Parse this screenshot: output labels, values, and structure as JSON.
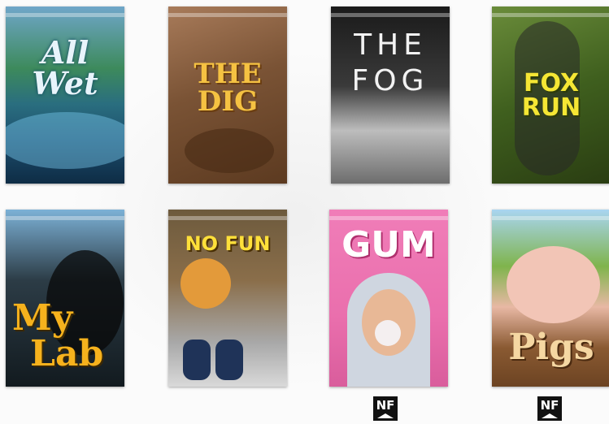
{
  "books": [
    {
      "title_line1": "All",
      "title_line2": "Wet"
    },
    {
      "title_line1": "THE",
      "title_line2": "DIG"
    },
    {
      "title_line1": "THE",
      "title_line2": "FOG"
    },
    {
      "title_line1": "FOX",
      "title_line2": "RUN"
    },
    {
      "title_line1": "My",
      "title_line2": "Lab"
    },
    {
      "title_line1": "NO FUN",
      "title_line2": ""
    },
    {
      "title_line1": "GUM",
      "title_line2": ""
    },
    {
      "title_line1": "Pigs",
      "title_line2": ""
    }
  ],
  "badges": {
    "nf_label": "NF"
  },
  "colors": {
    "background": "#fbfbfb",
    "badge": "#111111"
  }
}
